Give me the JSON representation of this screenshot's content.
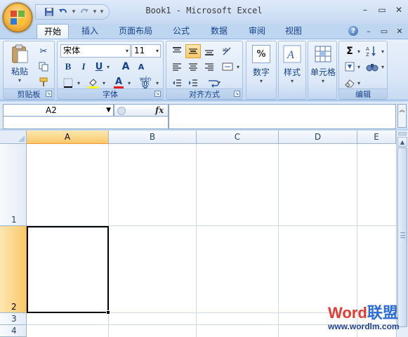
{
  "window": {
    "title": "Book1 - Microsoft Excel"
  },
  "quick_access": {
    "items": [
      "save-icon",
      "undo-icon",
      "redo-icon",
      "customize-icon"
    ]
  },
  "ribbon_tabs": [
    "开始",
    "插入",
    "页面布局",
    "公式",
    "数据",
    "审阅",
    "视图"
  ],
  "active_tab": "开始",
  "clipboard": {
    "label": "剪贴板",
    "paste_label": "粘贴"
  },
  "font": {
    "label": "字体",
    "name": "宋体",
    "size": "11",
    "bold": "B",
    "italic": "I",
    "underline": "U",
    "grow": "A",
    "shrink": "A",
    "font_color": "A",
    "phonetic": "wén",
    "phonetic_char": "变",
    "font_color_hex": "#e02020",
    "highlight_hex": "#ffff00"
  },
  "alignment": {
    "label": "对齐方式"
  },
  "number": {
    "label": "数字",
    "symbol": "%"
  },
  "styles": {
    "label": "样式"
  },
  "cells": {
    "label": "单元格"
  },
  "editing": {
    "label": "编辑",
    "sum": "Σ"
  },
  "formula_bar": {
    "name_box": "A2",
    "fx": "fx",
    "content": ""
  },
  "grid": {
    "columns": [
      "A",
      "B",
      "C",
      "D",
      "E"
    ],
    "rows": [
      "1",
      "2",
      "3",
      "4"
    ],
    "selected_cell": "A2",
    "selected_column": "A",
    "selected_row": "2"
  },
  "watermark": {
    "brand_a": "Word",
    "brand_b": "联盟",
    "url": "www.wordlm.com"
  }
}
